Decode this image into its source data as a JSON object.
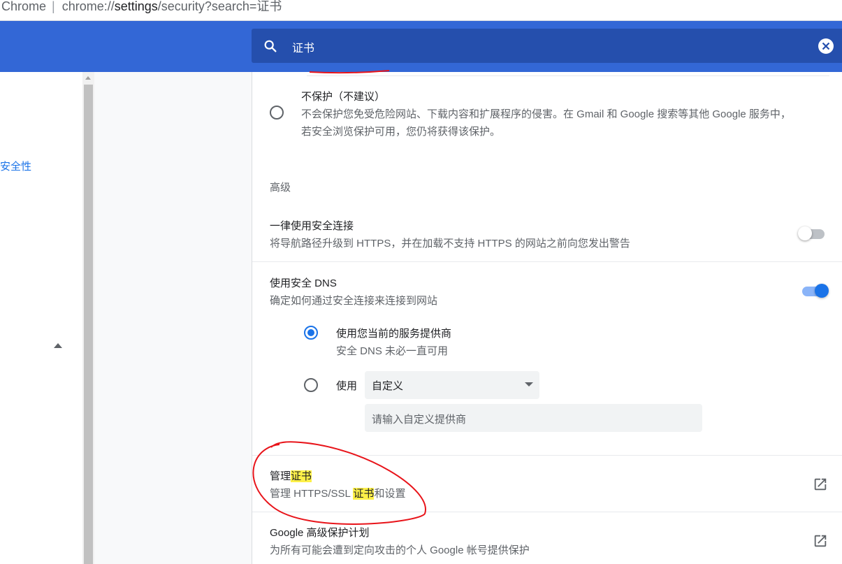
{
  "address_bar": {
    "origin": "Chrome",
    "separator": "|",
    "url_prefix": "chrome://",
    "url_host": "settings",
    "url_path": "/security?search=证书"
  },
  "search": {
    "query": "证书",
    "icon": "search-icon",
    "clear_icon": "close-icon"
  },
  "sidebar": {
    "items": [
      {
        "label": "安全性"
      }
    ]
  },
  "safe_browsing": {
    "no_protection": {
      "title": "不保护（不建议）",
      "desc_line1": "不会保护您免受危险网站、下载内容和扩展程序的侵害。在 Gmail 和 Google 搜索等其他 Google 服务中，",
      "desc_line2": "若安全浏览保护可用，您仍将获得该保护。"
    }
  },
  "advanced": {
    "heading": "高级",
    "https_only": {
      "title": "一律使用安全连接",
      "desc": "将导航路径升级到 HTTPS，并在加载不支持 HTTPS 的网站之前向您发出警告",
      "enabled": false
    },
    "secure_dns": {
      "title": "使用安全 DNS",
      "desc": "确定如何通过安全连接来连接到网站",
      "enabled": true,
      "option_current": {
        "title": "使用您当前的服务提供商",
        "desc": "安全 DNS 未必一直可用",
        "selected": true
      },
      "option_custom": {
        "label": "使用",
        "select_value": "自定义",
        "input_placeholder": "请输入自定义提供商",
        "selected": false
      }
    },
    "manage_certs": {
      "title_prefix": "管理",
      "title_highlight": "证书",
      "desc_prefix": "管理 HTTPS/SSL ",
      "desc_highlight": "证书",
      "desc_suffix": "和设置",
      "icon": "open-in-new-icon"
    },
    "advanced_protection": {
      "title": "Google 高级保护计划",
      "desc": "为所有可能会遭到定向攻击的个人 Google 帐号提供保护",
      "icon": "open-in-new-icon"
    }
  },
  "colors": {
    "header_blue": "#3367d6",
    "search_blue": "#254fad",
    "accent": "#1a73e8",
    "highlight": "#fdf048",
    "annotation_red": "#e8141a"
  }
}
